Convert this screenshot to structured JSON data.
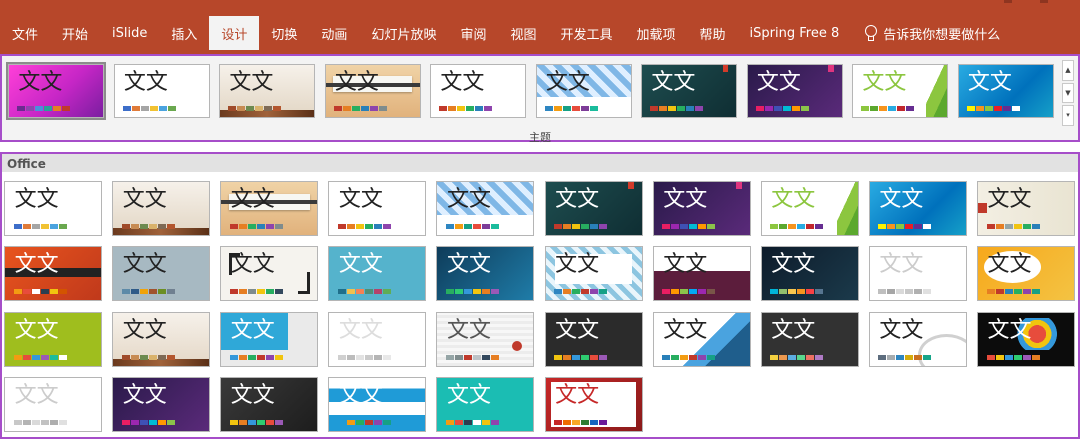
{
  "ribbon": {
    "tabs": [
      {
        "label": "文件",
        "active": false
      },
      {
        "label": "开始",
        "active": false
      },
      {
        "label": "iSlide",
        "active": false
      },
      {
        "label": "插入",
        "active": false
      },
      {
        "label": "设计",
        "active": true
      },
      {
        "label": "切换",
        "active": false
      },
      {
        "label": "动画",
        "active": false
      },
      {
        "label": "幻灯片放映",
        "active": false
      },
      {
        "label": "审阅",
        "active": false
      },
      {
        "label": "视图",
        "active": false
      },
      {
        "label": "开发工具",
        "active": false
      },
      {
        "label": "加载项",
        "active": false
      },
      {
        "label": "帮助",
        "active": false
      },
      {
        "label": "iSpring Free 8",
        "active": false
      }
    ],
    "tell_me": "告诉我你想要做什么",
    "tell_me_icon": "lightbulb-icon",
    "bg_color": "#b7472a"
  },
  "gallery_top": {
    "group_label": "主题",
    "scroll_icons": [
      "scroll-up-icon",
      "scroll-down-icon",
      "more-icon"
    ],
    "themes": [
      {
        "title": "文文",
        "bg": "linear-gradient(135deg,#ff3fd8,#c626c6 55%,#7a1ea0)",
        "color": "#222",
        "sw": [
          "#6b2b8f",
          "#8e44ad",
          "#4a90d9",
          "#2aa198",
          "#e67e22",
          "#c0392b"
        ]
      },
      {
        "title": "文文",
        "bg": "#ffffff",
        "color": "#222",
        "sw": [
          "#3d6ec9",
          "#e07b39",
          "#a5a5a5",
          "#f1c232",
          "#4aa3df",
          "#6aa84f"
        ]
      },
      {
        "title": "文文",
        "bg": "linear-gradient(180deg,#f6f1ea,#e2d6c4)",
        "color": "#222",
        "deco": "wood-bottom",
        "sw": [
          "#a04b2a",
          "#c78b53",
          "#6d8a4f",
          "#d9b26b",
          "#7f6a55",
          "#b3562e"
        ]
      },
      {
        "title": "文文",
        "bg": "linear-gradient(180deg,#f0d3a6,#e1b27c)",
        "color": "#222",
        "deco": "paper-strip",
        "sw": [
          "#c0392b",
          "#e67e22",
          "#27ae60",
          "#2980b9",
          "#8e44ad",
          "#7f8c8d"
        ]
      },
      {
        "title": "文文",
        "bg": "#ffffff",
        "color": "#222",
        "sw": [
          "#c0392b",
          "#e67e22",
          "#f1c40f",
          "#27ae60",
          "#2980b9",
          "#8e44ad"
        ]
      },
      {
        "title": "文文",
        "bg": "repeating-linear-gradient(45deg,#7fb7e6 0 6px,#dfefff 6px 12px)",
        "color": "#222",
        "deco": "white-bottom",
        "sw": [
          "#2e86c1",
          "#f39c12",
          "#16a085",
          "#e74c3c",
          "#7d3c98",
          "#1abc9c"
        ]
      },
      {
        "title": "文文",
        "bg": "linear-gradient(135deg,#1e4d4f,#0f2e33)",
        "color": "#ffffff",
        "deco": "red-corner",
        "sw": [
          "#c0392b",
          "#e67e22",
          "#f1c40f",
          "#27ae60",
          "#2980b9",
          "#8e44ad"
        ]
      },
      {
        "title": "文文",
        "bg": "linear-gradient(135deg,#2a1a4a,#5a2a7a)",
        "color": "#ffffff",
        "deco": "pink-corner",
        "sw": [
          "#e91e63",
          "#9c27b0",
          "#3f51b5",
          "#00bcd4",
          "#ff9800",
          "#8bc34a"
        ]
      },
      {
        "title": "文文",
        "bg": "#ffffff",
        "color": "#8cc63f",
        "deco": "green-slash",
        "sw": [
          "#8cc63f",
          "#5ba82e",
          "#f7941d",
          "#29abe2",
          "#c1272d",
          "#662d91"
        ]
      },
      {
        "title": "文文",
        "bg": "linear-gradient(135deg,#29abe2,#0071bc 60%,#16a0c8)",
        "color": "#ffffff",
        "sw": [
          "#fff200",
          "#f7941d",
          "#8cc63f",
          "#ed1c24",
          "#662d91",
          "#ffffff"
        ]
      }
    ]
  },
  "gallery_main": {
    "section_label": "Office",
    "themes": [
      {
        "title": "文文",
        "bg": "#ffffff",
        "color": "#222",
        "sw": [
          "#3d6ec9",
          "#e07b39",
          "#a5a5a5",
          "#f1c232",
          "#4aa3df",
          "#6aa84f"
        ]
      },
      {
        "title": "文文",
        "bg": "linear-gradient(180deg,#f6f1ea,#e2d6c4)",
        "color": "#222",
        "deco": "wood-bottom",
        "sw": [
          "#a04b2a",
          "#c78b53",
          "#6d8a4f",
          "#d9b26b",
          "#7f6a55",
          "#b3562e"
        ]
      },
      {
        "title": "文文",
        "bg": "linear-gradient(180deg,#f0d3a6,#e1b27c)",
        "color": "#222",
        "deco": "paper-strip",
        "sw": [
          "#c0392b",
          "#e67e22",
          "#27ae60",
          "#2980b9",
          "#8e44ad",
          "#7f8c8d"
        ]
      },
      {
        "title": "文文",
        "bg": "#ffffff",
        "color": "#222",
        "sw": [
          "#c0392b",
          "#e67e22",
          "#f1c40f",
          "#27ae60",
          "#2980b9",
          "#8e44ad"
        ]
      },
      {
        "title": "文文",
        "bg": "repeating-linear-gradient(45deg,#7fb7e6 0 6px,#dfefff 6px 12px)",
        "color": "#222",
        "deco": "white-bottom",
        "sw": [
          "#2e86c1",
          "#f39c12",
          "#16a085",
          "#e74c3c",
          "#7d3c98",
          "#1abc9c"
        ]
      },
      {
        "title": "文文",
        "bg": "linear-gradient(135deg,#1e4d4f,#0f2e33)",
        "color": "#ffffff",
        "deco": "red-corner",
        "sw": [
          "#c0392b",
          "#e67e22",
          "#f1c40f",
          "#27ae60",
          "#2980b9",
          "#8e44ad"
        ]
      },
      {
        "title": "文文",
        "bg": "linear-gradient(135deg,#2a1a4a,#5a2a7a)",
        "color": "#ffffff",
        "deco": "pink-corner",
        "sw": [
          "#e91e63",
          "#9c27b0",
          "#3f51b5",
          "#00bcd4",
          "#ff9800",
          "#8bc34a"
        ]
      },
      {
        "title": "文文",
        "bg": "#ffffff",
        "color": "#8cc63f",
        "deco": "green-slash",
        "sw": [
          "#8cc63f",
          "#5ba82e",
          "#f7941d",
          "#29abe2",
          "#c1272d",
          "#662d91"
        ]
      },
      {
        "title": "文文",
        "bg": "linear-gradient(135deg,#29abe2,#0071bc 60%,#16a0c8)",
        "color": "#ffffff",
        "sw": [
          "#fff200",
          "#f7941d",
          "#8cc63f",
          "#ed1c24",
          "#662d91",
          "#ffffff"
        ]
      },
      {
        "title": "文文",
        "bg": "linear-gradient(90deg,#f3efe3,#e9e4d2)",
        "color": "#222",
        "deco": "red-tag",
        "sw": [
          "#c0392b",
          "#e67e22",
          "#95a5a6",
          "#f1c40f",
          "#27ae60",
          "#2980b9"
        ]
      },
      {
        "title": "文文",
        "bg": "linear-gradient(135deg,#e8541e,#c0391b)",
        "color": "#ffffff",
        "deco": "dark-band",
        "sw": [
          "#f39c12",
          "#e74c3c",
          "#ffffff",
          "#2c3e50",
          "#f1c40f",
          "#d35400"
        ]
      },
      {
        "title": "文文",
        "bg": "#a7b9c2",
        "color": "#222",
        "sw": [
          "#5d8aa8",
          "#2e5a88",
          "#f0a30a",
          "#a0522d",
          "#6b8e23",
          "#708090"
        ]
      },
      {
        "title": "文文",
        "bg": "#f5f3ee",
        "color": "#222",
        "deco": "frame",
        "sw": [
          "#c0392b",
          "#e67e22",
          "#7f8c8d",
          "#f1c40f",
          "#27ae60",
          "#34495e"
        ]
      },
      {
        "title": "文文",
        "bg": "#55b3cc",
        "color": "#ffffff",
        "sw": [
          "#1f6f8b",
          "#f2c14e",
          "#f78154",
          "#4d9078",
          "#b4436c",
          "#5fad56"
        ]
      },
      {
        "title": "文文",
        "bg": "linear-gradient(135deg,#0e3c5a,#1f7ca8)",
        "color": "#ffffff",
        "sw": [
          "#27ae60",
          "#2ecc71",
          "#3498db",
          "#f1c40f",
          "#e67e22",
          "#9b59b6"
        ]
      },
      {
        "title": "文文",
        "bg": "repeating-linear-gradient(45deg,#8cc5e0 0 5px,#e9f5fb 5px 10px)",
        "color": "#222",
        "deco": "white-box",
        "sw": [
          "#2e86c1",
          "#e67e22",
          "#27ae60",
          "#c0392b",
          "#8e44ad",
          "#16a085"
        ]
      },
      {
        "title": "文文",
        "bg": "linear-gradient(180deg,#ffffff 0 45%,#5c1d3c 45% 100%)",
        "color": "#222",
        "sw": [
          "#e91e63",
          "#ff9800",
          "#8bc34a",
          "#03a9f4",
          "#9c27b0",
          "#795548"
        ]
      },
      {
        "title": "文文",
        "bg": "linear-gradient(135deg,#0d1b2a,#1b3a4b)",
        "color": "#ffffff",
        "sw": [
          "#00b4d8",
          "#90be6d",
          "#f9c74f",
          "#f8961e",
          "#f94144",
          "#577590"
        ]
      },
      {
        "title": "文文",
        "bg": "#ffffff",
        "color": "#cccccc",
        "sw": [
          "#bfbfbf",
          "#a6a6a6",
          "#d9d9d9",
          "#c8c8c8",
          "#b0b0b0",
          "#e0e0e0"
        ]
      },
      {
        "title": "文文",
        "bg": "linear-gradient(135deg,#f7a81b,#f3c343)",
        "color": "#222",
        "deco": "white-blob",
        "sw": [
          "#e67e22",
          "#c0392b",
          "#2980b9",
          "#27ae60",
          "#8e44ad",
          "#16a085"
        ]
      },
      {
        "title": "文文",
        "bg": "#9fbe1e",
        "color": "#ffffff",
        "sw": [
          "#f39c12",
          "#e74c3c",
          "#3498db",
          "#9b59b6",
          "#1abc9c",
          "#ffffff"
        ]
      },
      {
        "title": "文文",
        "bg": "linear-gradient(180deg,#f6f1ea,#e4d7c6)",
        "color": "#222",
        "deco": "wood-bottom",
        "sw": [
          "#a04b2a",
          "#c78b53",
          "#6d8a4f",
          "#d9b26b",
          "#7f6a55",
          "#b3562e"
        ]
      },
      {
        "title": "文文",
        "bg": "linear-gradient(90deg,#2fa8d8 0 70%,#eaeaea 70% 100%)",
        "color": "#ffffff",
        "deco": "grey-bottom",
        "sw": [
          "#3498db",
          "#e67e22",
          "#27ae60",
          "#c0392b",
          "#8e44ad",
          "#f1c40f"
        ]
      },
      {
        "title": "文文",
        "bg": "#ffffff",
        "color": "#dddddd",
        "sw": [
          "#d0d0d0",
          "#bcbcbc",
          "#e2e2e2",
          "#cacaca",
          "#b5b5b5",
          "#e8e8e8"
        ]
      },
      {
        "title": "文文",
        "bg": "repeating-linear-gradient(0deg,#ececec 0 3px,#f7f7f7 3px 6px)",
        "color": "#555",
        "deco": "red-dot",
        "sw": [
          "#95a5a6",
          "#7f8c8d",
          "#c0392b",
          "#bdc3c7",
          "#34495e",
          "#e67e22"
        ]
      },
      {
        "title": "文文",
        "bg": "#2b2b2b",
        "color": "#ffffff",
        "sw": [
          "#f1c40f",
          "#e67e22",
          "#3498db",
          "#2ecc71",
          "#e74c3c",
          "#9b59b6"
        ]
      },
      {
        "title": "文文",
        "bg": "linear-gradient(135deg,#ffffff 0 55%,#4aa3df 55% 70%,#1f5e8c 70% 100%)",
        "color": "#222",
        "sw": [
          "#2980b9",
          "#27ae60",
          "#f39c12",
          "#c0392b",
          "#8e44ad",
          "#16a085"
        ]
      },
      {
        "title": "文文",
        "bg": "#323232",
        "color": "#ffffff",
        "sw": [
          "#f4d03f",
          "#eb984e",
          "#5dade2",
          "#58d68d",
          "#ec7063",
          "#af7ac5"
        ]
      },
      {
        "title": "文文",
        "bg": "#ffffff",
        "color": "#222",
        "deco": "grey-swirl",
        "sw": [
          "#5d6d7e",
          "#a6acaf",
          "#2e86c1",
          "#d4ac0d",
          "#ca6f1e",
          "#17a589"
        ]
      },
      {
        "title": "文文",
        "bg": "#0c0c0c",
        "color": "#ffffff",
        "deco": "paint-splash",
        "sw": [
          "#e74c3c",
          "#f1c40f",
          "#3498db",
          "#2ecc71",
          "#9b59b6",
          "#e67e22"
        ]
      },
      {
        "title": "文文",
        "bg": "#ffffff",
        "color": "#cccccc",
        "sw": [
          "#c8c8c8",
          "#b4b4b4",
          "#dadada",
          "#c2c2c2",
          "#aeaeae",
          "#e0e0e0"
        ]
      },
      {
        "title": "文文",
        "bg": "linear-gradient(135deg,#2a1a4a,#5a2a7a)",
        "color": "#ffffff",
        "sw": [
          "#e91e63",
          "#9c27b0",
          "#3f51b5",
          "#00bcd4",
          "#ff9800",
          "#8bc34a"
        ]
      },
      {
        "title": "文文",
        "bg": "linear-gradient(135deg,#3a3a3a,#1d1d1d)",
        "color": "#ffffff",
        "sw": [
          "#f1c40f",
          "#e67e22",
          "#3498db",
          "#2ecc71",
          "#e74c3c",
          "#9b59b6"
        ]
      },
      {
        "title": "文文",
        "bg": "linear-gradient(180deg,#ffffff 0 20%,#1f9bd7 20% 45%,#ffffff 45% 70%,#1f9bd7 70% 100%)",
        "color": "#ffffff",
        "sw": [
          "#1f9bd7",
          "#f39c12",
          "#27ae60",
          "#c0392b",
          "#8e44ad",
          "#16a085"
        ]
      },
      {
        "title": "文文",
        "bg": "#1bbdb3",
        "color": "#ffffff",
        "sw": [
          "#f39c12",
          "#e74c3c",
          "#2c3e50",
          "#ffffff",
          "#f1c40f",
          "#8e44ad"
        ]
      },
      {
        "title": "文文",
        "bg": "linear-gradient(135deg,#c62828,#8b1a1a)",
        "color": "#c62828",
        "deco": "red-frame",
        "sw": [
          "#c62828",
          "#ef6c00",
          "#f9a825",
          "#2e7d32",
          "#1565c0",
          "#6a1b9a"
        ]
      }
    ]
  }
}
